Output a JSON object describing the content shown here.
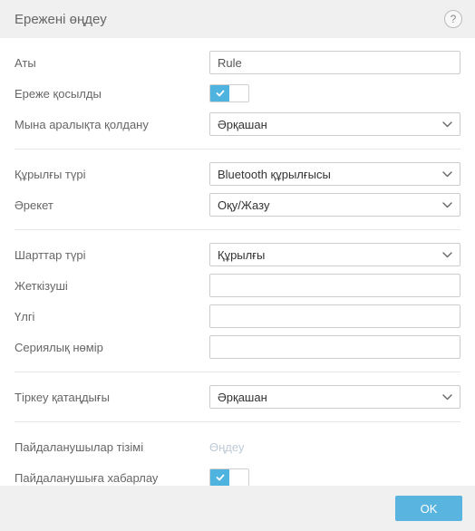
{
  "header": {
    "title": "Ережені өңдеу",
    "help_tooltip": "?"
  },
  "fields": {
    "name": {
      "label": "Аты",
      "value": "Rule"
    },
    "rule_enabled": {
      "label": "Ереже қосылды",
      "value": true
    },
    "apply_during": {
      "label": "Мына аралықта қолдану",
      "value": "Әрқашан"
    },
    "device_type": {
      "label": "Құрылғы түрі",
      "value": "Bluetooth құрылғысы"
    },
    "action": {
      "label": "Әрекет",
      "value": "Оқу/Жазу"
    },
    "criteria_type": {
      "label": "Шарттар түрі",
      "value": "Құрылғы"
    },
    "vendor": {
      "label": "Жеткізуші",
      "value": ""
    },
    "model": {
      "label": "Үлгі",
      "value": ""
    },
    "serial": {
      "label": "Сериялық нөмір",
      "value": ""
    },
    "logging_severity": {
      "label": "Тіркеу қатаңдығы",
      "value": "Әрқашан"
    },
    "user_list": {
      "label": "Пайдаланушылар тізімі",
      "link_text": "Өңдеу"
    },
    "notify_user": {
      "label": "Пайдаланушыға хабарлау",
      "value": true
    }
  },
  "footer": {
    "ok_label": "OK"
  }
}
